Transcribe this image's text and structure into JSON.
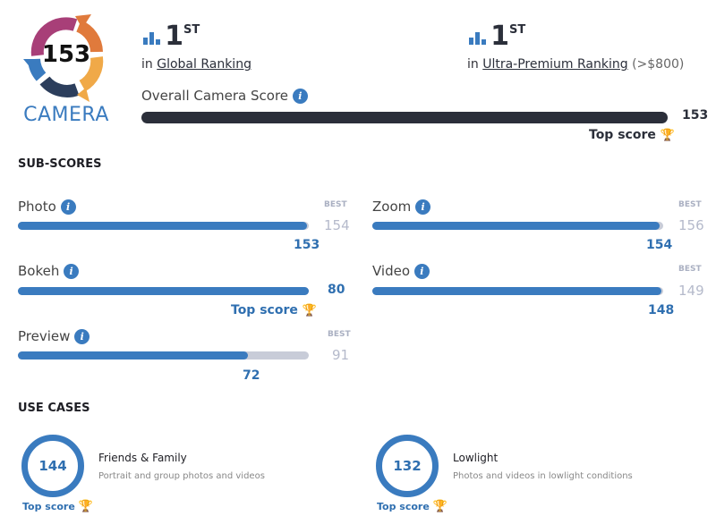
{
  "badge": {
    "score": "153",
    "label": "CAMERA"
  },
  "rankings": [
    {
      "rank": "1",
      "suffix": "ST",
      "prefix": "in",
      "link": "Global Ranking",
      "extra": ""
    },
    {
      "rank": "1",
      "suffix": "ST",
      "prefix": "in",
      "link": "Ultra-Premium Ranking",
      "extra": "(>$800)"
    }
  ],
  "overall": {
    "label": "Overall Camera Score",
    "info": "i",
    "score": "153",
    "fill_fraction": 1.0,
    "top_score": "Top score",
    "trophy": "🏆"
  },
  "sub_scores": {
    "title": "SUB-SCORES",
    "best_label": "BEST",
    "items": [
      {
        "name": "Photo",
        "score": "153",
        "best": "154",
        "fill_fraction": 0.9935,
        "top_score": ""
      },
      {
        "name": "Zoom",
        "score": "154",
        "best": "156",
        "fill_fraction": 0.987,
        "top_score": ""
      },
      {
        "name": "Bokeh",
        "score": "80",
        "best": "",
        "fill_fraction": 1.0,
        "top_score": "Top score"
      },
      {
        "name": "Video",
        "score": "148",
        "best": "149",
        "fill_fraction": 0.993,
        "top_score": ""
      },
      {
        "name": "Preview",
        "score": "72",
        "best": "91",
        "fill_fraction": 0.791,
        "top_score": ""
      }
    ]
  },
  "use_cases": {
    "title": "USE CASES",
    "items": [
      {
        "score": "144",
        "title": "Friends & Family",
        "desc": "Portrait and group photos and videos",
        "top_score": "Top score"
      },
      {
        "score": "132",
        "title": "Lowlight",
        "desc": "Photos and videos in lowlight conditions",
        "top_score": "Top score"
      }
    ]
  },
  "colors": {
    "accent": "#3a7bbf",
    "dark_bar": "#2b2f3a",
    "track": "#c8ccd8",
    "trophy": "#f2b23c"
  }
}
